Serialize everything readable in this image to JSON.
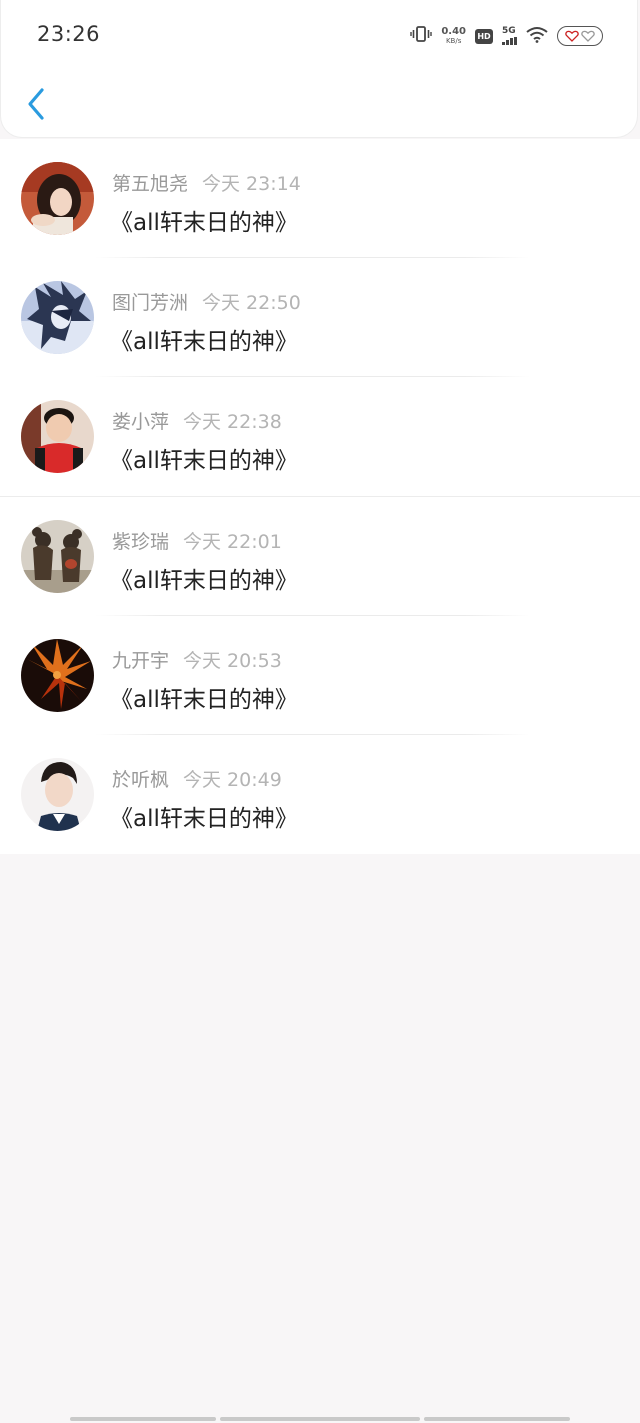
{
  "status_bar": {
    "time": "23:26",
    "net_speed_value": "0.40",
    "net_speed_unit": "KB/s",
    "hd_label": "HD",
    "signal_label": "5G"
  },
  "header": {
    "back_icon": "chevron-left-icon",
    "accent_color": "#2a9bdf"
  },
  "comments": [
    {
      "username": "第五旭尧",
      "time": "今天 23:14",
      "text": "《all轩末日的神》"
    },
    {
      "username": "图门芳洲",
      "time": "今天 22:50",
      "text": "《all轩末日的神》"
    },
    {
      "username": "娄小萍",
      "time": "今天 22:38",
      "text": "《all轩末日的神》"
    },
    {
      "username": "紫珍瑞",
      "time": "今天 22:01",
      "text": "《all轩末日的神》"
    },
    {
      "username": "九开宇",
      "time": "今天 20:53",
      "text": "《all轩末日的神》"
    },
    {
      "username": "於听枫",
      "time": "今天 20:49",
      "text": "《all轩末日的神》"
    }
  ]
}
